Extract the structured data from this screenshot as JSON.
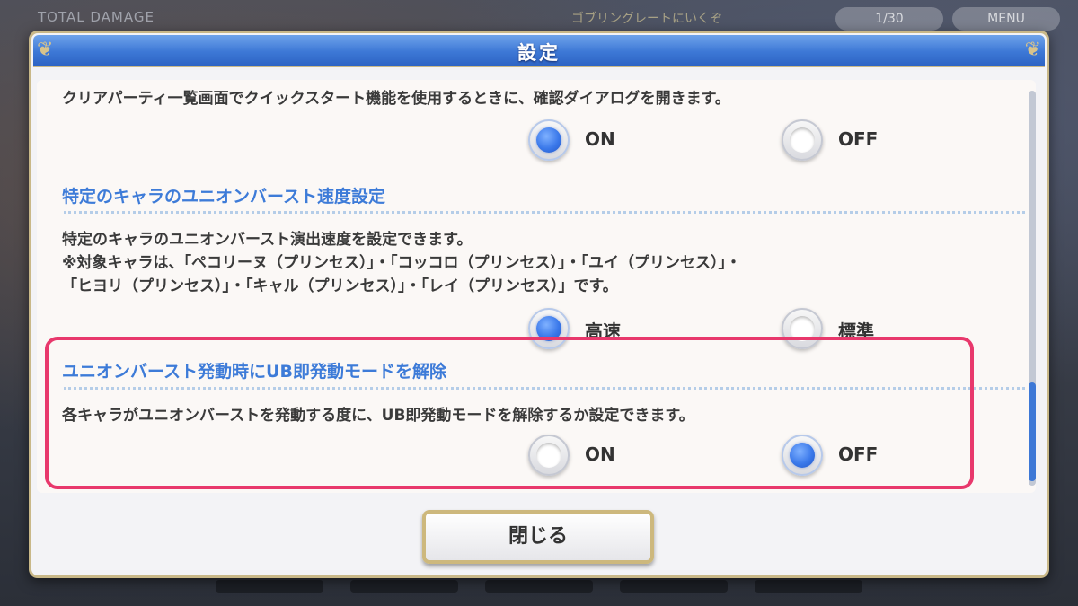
{
  "background": {
    "hud_left": "TOTAL DAMAGE",
    "hud_badge": "",
    "hud_right": "ゴブリングレートにいくぞ",
    "pill_1": "1/30",
    "pill_2": "MENU"
  },
  "dialog": {
    "title": "設定",
    "section1": {
      "description": "クリアパーティ一覧画面でクイックスタート機能を使用するときに、確認ダイアログを開きます。",
      "option_on": "ON",
      "option_off": "OFF",
      "selected": "ON"
    },
    "section2": {
      "heading": "特定のキャラのユニオンバースト速度設定",
      "desc_line1": "特定のキャラのユニオンバースト演出速度を設定できます。",
      "desc_line2": "※対象キャラは、「ペコリーヌ（プリンセス）」・「コッコロ（プリンセス）」・「ユイ（プリンセス）」・",
      "desc_line3": "「ヒヨリ（プリンセス）」・「キャル（プリンセス）」・「レイ（プリンセス）」です。",
      "option_fast": "高速",
      "option_normal": "標準",
      "selected": "高速"
    },
    "section3": {
      "heading": "ユニオンバースト発動時にUB即発動モードを解除",
      "description": "各キャラがユニオンバーストを発動する度に、UB即発動モードを解除するか設定できます。",
      "option_on": "ON",
      "option_off": "OFF",
      "selected": "OFF"
    },
    "close_label": "閉じる"
  },
  "colors": {
    "accent_blue": "#3d7bd8",
    "highlight_pink": "#e8386c",
    "gold_border": "#c9b888"
  }
}
